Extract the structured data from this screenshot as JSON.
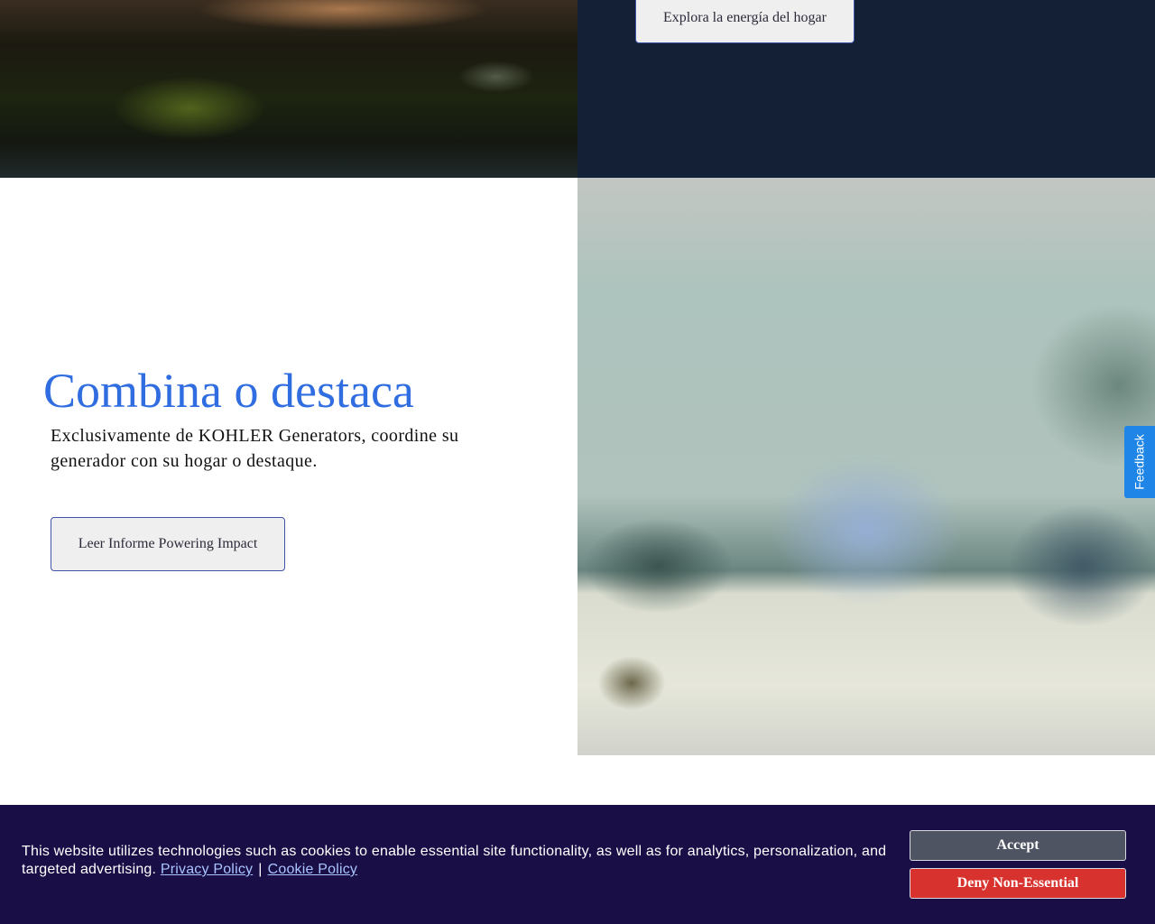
{
  "hero_top": {
    "button_label": "Explora la energía del hogar"
  },
  "feature": {
    "title": "Combina o destaca",
    "description": "Exclusivamente de KOHLER Generators, coordine su generador con su hogar o destaque.",
    "button_label": "Leer Informe Powering Impact"
  },
  "feedback": {
    "label": "Feedback",
    "color": "#1f86e8"
  },
  "cookie_banner": {
    "text": "This website utilizes technologies such as cookies to enable essential site functionality, as well as for analytics, personalization, and targeted advertising.",
    "privacy_link": "Privacy Policy",
    "separator": "|",
    "cookie_link": "Cookie Policy",
    "accept_label": "Accept",
    "deny_label": "Deny Non-Essential",
    "background_color": "#1a0e46",
    "accept_color": "#4f5463",
    "deny_color": "#d8322e"
  },
  "colors": {
    "headline": "#2f6de0",
    "top_panel": "#132035",
    "button_border": "#4054a8"
  }
}
